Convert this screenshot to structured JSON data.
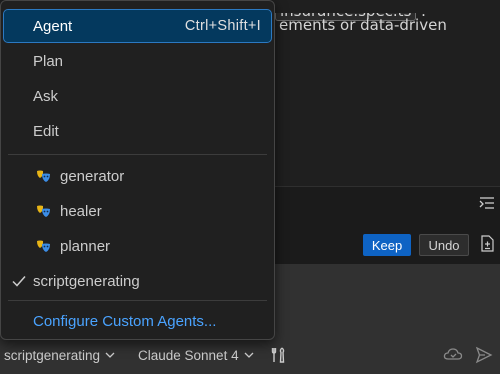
{
  "background": {
    "line1_code": "insurance.spec.ts",
    "line1_suffix": ".",
    "line2": "ements or data-driven"
  },
  "actions": {
    "keep_label": "Keep",
    "undo_label": "Undo"
  },
  "menu": {
    "modes": [
      {
        "label": "Agent",
        "shortcut": "Ctrl+Shift+I",
        "selected": true
      },
      {
        "label": "Plan"
      },
      {
        "label": "Ask"
      },
      {
        "label": "Edit"
      }
    ],
    "agents": [
      {
        "label": "generator",
        "icon": "agent-mask-icon"
      },
      {
        "label": "healer",
        "icon": "agent-mask-icon"
      },
      {
        "label": "planner",
        "icon": "agent-mask-icon"
      }
    ],
    "checked_item": {
      "label": "scriptgenerating",
      "icon": "check-icon"
    },
    "configure_link": "Configure Custom Agents..."
  },
  "bottom_bar": {
    "mode_picker": "scriptgenerating",
    "model_picker": "Claude Sonnet 4"
  },
  "colors": {
    "accent": "#0e63c4",
    "selection_bg": "#04395e",
    "link": "#4aa3ff",
    "menu_bg": "#202020"
  }
}
